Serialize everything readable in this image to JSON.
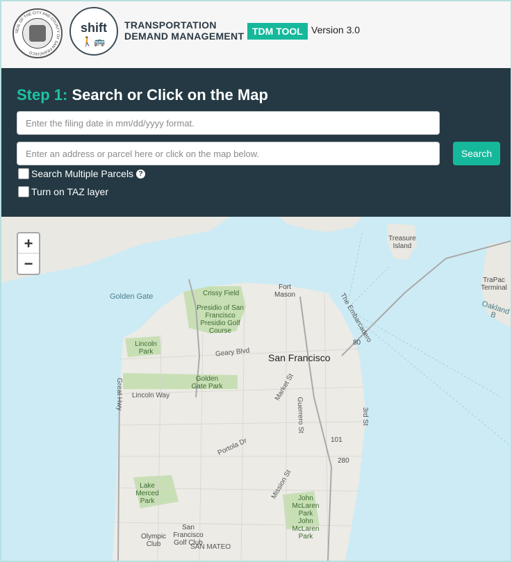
{
  "header": {
    "seal_text": "SEAL OF THE CITY AND COUNTY OF SAN FRANCISCO",
    "shift_logo_text": "shift",
    "brand_line1": "TRANSPORTATION",
    "brand_line2": "DEMAND MANAGEMENT",
    "badge": "TDM TOOL",
    "version": "Version 3.0"
  },
  "panel": {
    "step_number": "Step 1:",
    "step_title": "Search or Click on the Map",
    "date_placeholder": "Enter the filing date in mm/dd/yyyy format.",
    "address_placeholder": "Enter an address or parcel here or click on the map below.",
    "search_label": "Search",
    "multiple_parcels_label": "Search Multiple Parcels",
    "taz_label": "Turn on TAZ layer",
    "help_icon": "question-circle-icon"
  },
  "map": {
    "zoom_in": "+",
    "zoom_out": "−",
    "labels": {
      "treasure_island": "Treasure Island",
      "golden_gate": "Golden Gate",
      "crissy_field": "Crissy Field",
      "fort_mason": "Fort Mason",
      "presidio": "Presidio of San Francisco Presidio Golf Course",
      "trapac": "TraPac Terminal",
      "oakland": "Oakland B",
      "embarcadero": "The Embarcadero",
      "lincoln_park": "Lincoln Park",
      "geary": "Geary Blvd",
      "san_francisco": "San Francisco",
      "great_hwy": "Great Hwy",
      "golden_gate_park": "Golden Gate Park",
      "lincoln_way": "Lincoln Way",
      "market": "Market St",
      "guerrero": "Guerrero St",
      "third": "3rd St",
      "portola": "Portola Dr",
      "i80": "80",
      "i101": "101",
      "i280": "280",
      "lake_merced": "Lake Merced Park",
      "mission": "Mission St",
      "john_mclaren": "John McLaren Park John McLaren Park",
      "olympic": "Olympic Club",
      "sf_golf": "San Francisco Golf Club",
      "san_mateo": "SAN MATEO"
    }
  }
}
